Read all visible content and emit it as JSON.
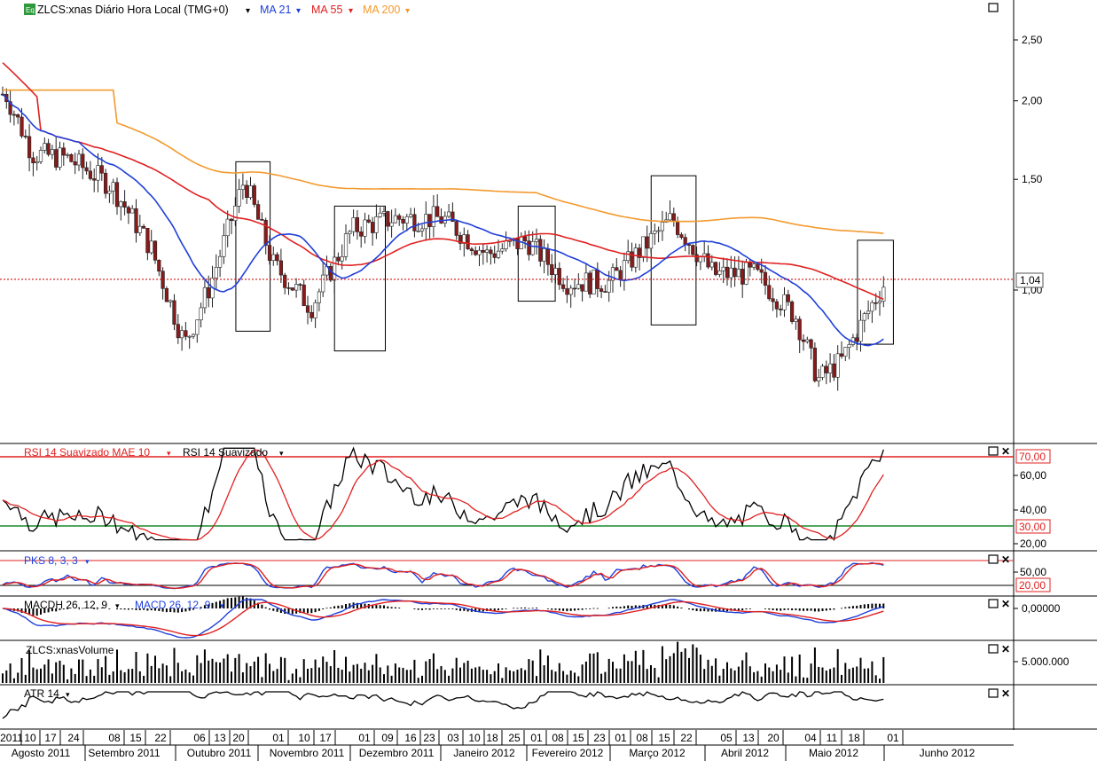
{
  "header": {
    "icon_label": "Eq",
    "symbol_label": "ZLCS:xnas Diário Hora Local (TMG+0)",
    "ma21_label": "MA 21",
    "ma55_label": "MA 55",
    "ma200_label": "MA 200",
    "dropdown_glyph": "▾",
    "ma21_color": "#1f3fd9",
    "ma55_color": "#e02020",
    "ma200_color": "#f39a2e"
  },
  "price_axis": {
    "ticks": [
      "2,50",
      "2,00",
      "1,50",
      "1,00"
    ],
    "tick_values": [
      2.5,
      2.0,
      1.5,
      1.0
    ],
    "last_price_label": "1,04",
    "last_price": 1.04
  },
  "rsi_panel": {
    "label_smoothed": "RSI 14 Suavizado MAE 10",
    "label_rsi": "RSI 14 Suavizado",
    "ticks": [
      "60,00",
      "40,00",
      "20,00"
    ],
    "upper_label": "70,00",
    "lower_label": "30,00"
  },
  "pks_panel": {
    "label": "PKS 8, 3, 3",
    "ticks": [
      "50,00"
    ],
    "lower_label": "20,00"
  },
  "macd_panel": {
    "label_hist": "MACDH 26, 12, 9",
    "label_macd": "MACD 26, 12, 9",
    "ticks": [
      "0,00000"
    ]
  },
  "volume_panel": {
    "label": "ZLCS:xnasVolume",
    "ticks": [
      "5.000.000"
    ]
  },
  "atr_panel": {
    "label": "ATR 14"
  },
  "panel_buttons": {
    "maximize_glyph": "□",
    "close_glyph": "✕"
  },
  "time_axis": {
    "days": [
      "2011",
      "10",
      "17",
      "24",
      "08",
      "15",
      "22",
      "06",
      "13",
      "20",
      "01",
      "10",
      "17",
      "01",
      "09",
      "16",
      "23",
      "03",
      "10",
      "18",
      "25",
      "01",
      "08",
      "15",
      "23",
      "01",
      "08",
      "15",
      "22",
      "05",
      "13",
      "20",
      "04",
      "11",
      "18",
      "01"
    ],
    "months": [
      "Agosto 2011",
      "Setembro 2011",
      "Outubro 2011",
      "Novembro 2011",
      "Dezembro 2011",
      "Janeiro 2012",
      "Fevereiro 2012",
      "Março 2012",
      "Abril 2012",
      "Maio 2012",
      "Junho 2012"
    ]
  },
  "chart_data": {
    "type": "candlestick",
    "title": "ZLCS:xnas Diário Hora Local (TMG+0)",
    "y_scale": "log",
    "ylim": [
      0.55,
      2.75
    ],
    "grid": false,
    "highlight_boxes": 6,
    "series": [
      {
        "name": "MA 21",
        "color": "#1f3fd9"
      },
      {
        "name": "MA 55",
        "color": "#e02020"
      },
      {
        "name": "MA 200",
        "color": "#f39a2e"
      }
    ],
    "key_levels": {
      "last_close": 1.04,
      "ma21_last": 0.87,
      "ma55_last": 1.0,
      "ma200_last": 1.15
    },
    "approx_closes": [
      {
        "x": "2011-08-03",
        "close": 2.05
      },
      {
        "x": "2011-08-12",
        "close": 1.65
      },
      {
        "x": "2011-08-24",
        "close": 1.62
      },
      {
        "x": "2011-09-08",
        "close": 1.47
      },
      {
        "x": "2011-09-22",
        "close": 1.17
      },
      {
        "x": "2011-10-04",
        "close": 0.82
      },
      {
        "x": "2011-10-13",
        "close": 1.02
      },
      {
        "x": "2011-10-25",
        "close": 1.5
      },
      {
        "x": "2011-11-04",
        "close": 1.1
      },
      {
        "x": "2011-11-17",
        "close": 0.94
      },
      {
        "x": "2011-12-01",
        "close": 1.25
      },
      {
        "x": "2011-12-16",
        "close": 1.3
      },
      {
        "x": "2012-01-03",
        "close": 1.3
      },
      {
        "x": "2012-01-18",
        "close": 1.14
      },
      {
        "x": "2012-02-01",
        "close": 1.2
      },
      {
        "x": "2012-02-15",
        "close": 1.03
      },
      {
        "x": "2012-03-01",
        "close": 1.03
      },
      {
        "x": "2012-03-22",
        "close": 1.3
      },
      {
        "x": "2012-04-05",
        "close": 1.06
      },
      {
        "x": "2012-04-20",
        "close": 1.06
      },
      {
        "x": "2012-05-04",
        "close": 0.91
      },
      {
        "x": "2012-05-11",
        "close": 0.72
      },
      {
        "x": "2012-05-18",
        "close": 0.77
      },
      {
        "x": "2012-05-28",
        "close": 0.96
      },
      {
        "x": "2012-06-01",
        "close": 1.04
      }
    ]
  }
}
